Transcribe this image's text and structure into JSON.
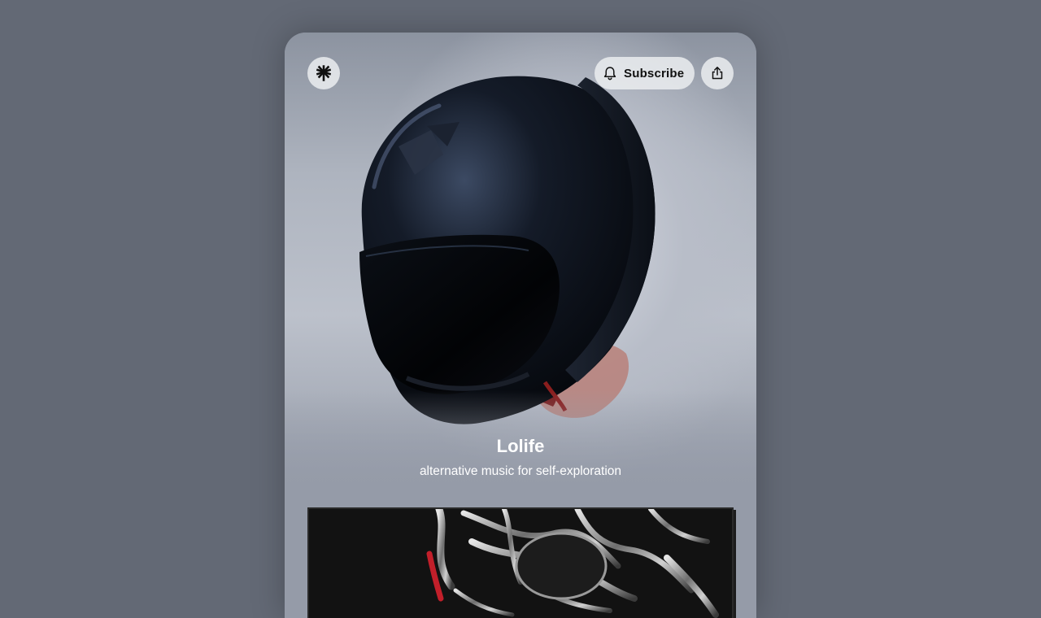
{
  "profile": {
    "name": "Lolife",
    "bio": "alternative music for self-exploration"
  },
  "header": {
    "logo_icon": "linktree-asterisk-icon",
    "subscribe_label": "Subscribe",
    "subscribe_icon": "bell-icon",
    "share_icon": "share-icon"
  },
  "hero": {
    "image": "black-motorcycle-helmet-in-fog"
  },
  "featured_link": {
    "image": "chrome-biomechanical-artwork"
  },
  "colors": {
    "page_background": "#636975",
    "card_background": "#959ba8",
    "button_background": "#ebedf0",
    "text_light": "#ffffff",
    "text_dark": "#111111"
  }
}
